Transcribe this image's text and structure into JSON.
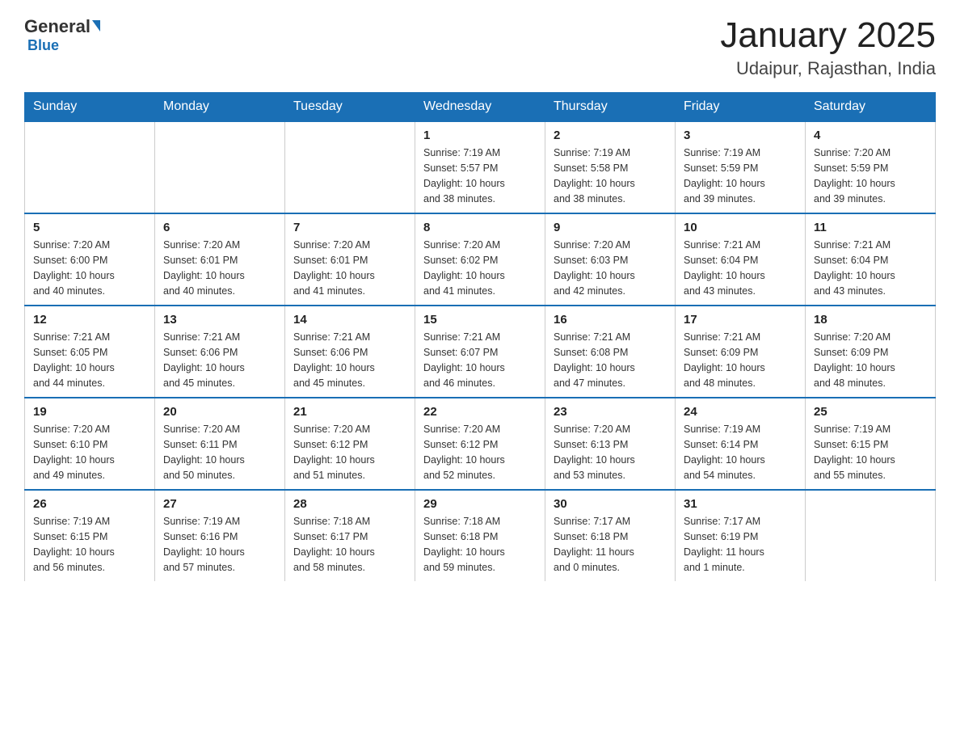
{
  "header": {
    "logo_general": "General",
    "logo_blue": "Blue",
    "month_title": "January 2025",
    "location": "Udaipur, Rajasthan, India"
  },
  "days_of_week": [
    "Sunday",
    "Monday",
    "Tuesday",
    "Wednesday",
    "Thursday",
    "Friday",
    "Saturday"
  ],
  "weeks": [
    [
      {
        "day": "",
        "info": ""
      },
      {
        "day": "",
        "info": ""
      },
      {
        "day": "",
        "info": ""
      },
      {
        "day": "1",
        "info": "Sunrise: 7:19 AM\nSunset: 5:57 PM\nDaylight: 10 hours\nand 38 minutes."
      },
      {
        "day": "2",
        "info": "Sunrise: 7:19 AM\nSunset: 5:58 PM\nDaylight: 10 hours\nand 38 minutes."
      },
      {
        "day": "3",
        "info": "Sunrise: 7:19 AM\nSunset: 5:59 PM\nDaylight: 10 hours\nand 39 minutes."
      },
      {
        "day": "4",
        "info": "Sunrise: 7:20 AM\nSunset: 5:59 PM\nDaylight: 10 hours\nand 39 minutes."
      }
    ],
    [
      {
        "day": "5",
        "info": "Sunrise: 7:20 AM\nSunset: 6:00 PM\nDaylight: 10 hours\nand 40 minutes."
      },
      {
        "day": "6",
        "info": "Sunrise: 7:20 AM\nSunset: 6:01 PM\nDaylight: 10 hours\nand 40 minutes."
      },
      {
        "day": "7",
        "info": "Sunrise: 7:20 AM\nSunset: 6:01 PM\nDaylight: 10 hours\nand 41 minutes."
      },
      {
        "day": "8",
        "info": "Sunrise: 7:20 AM\nSunset: 6:02 PM\nDaylight: 10 hours\nand 41 minutes."
      },
      {
        "day": "9",
        "info": "Sunrise: 7:20 AM\nSunset: 6:03 PM\nDaylight: 10 hours\nand 42 minutes."
      },
      {
        "day": "10",
        "info": "Sunrise: 7:21 AM\nSunset: 6:04 PM\nDaylight: 10 hours\nand 43 minutes."
      },
      {
        "day": "11",
        "info": "Sunrise: 7:21 AM\nSunset: 6:04 PM\nDaylight: 10 hours\nand 43 minutes."
      }
    ],
    [
      {
        "day": "12",
        "info": "Sunrise: 7:21 AM\nSunset: 6:05 PM\nDaylight: 10 hours\nand 44 minutes."
      },
      {
        "day": "13",
        "info": "Sunrise: 7:21 AM\nSunset: 6:06 PM\nDaylight: 10 hours\nand 45 minutes."
      },
      {
        "day": "14",
        "info": "Sunrise: 7:21 AM\nSunset: 6:06 PM\nDaylight: 10 hours\nand 45 minutes."
      },
      {
        "day": "15",
        "info": "Sunrise: 7:21 AM\nSunset: 6:07 PM\nDaylight: 10 hours\nand 46 minutes."
      },
      {
        "day": "16",
        "info": "Sunrise: 7:21 AM\nSunset: 6:08 PM\nDaylight: 10 hours\nand 47 minutes."
      },
      {
        "day": "17",
        "info": "Sunrise: 7:21 AM\nSunset: 6:09 PM\nDaylight: 10 hours\nand 48 minutes."
      },
      {
        "day": "18",
        "info": "Sunrise: 7:20 AM\nSunset: 6:09 PM\nDaylight: 10 hours\nand 48 minutes."
      }
    ],
    [
      {
        "day": "19",
        "info": "Sunrise: 7:20 AM\nSunset: 6:10 PM\nDaylight: 10 hours\nand 49 minutes."
      },
      {
        "day": "20",
        "info": "Sunrise: 7:20 AM\nSunset: 6:11 PM\nDaylight: 10 hours\nand 50 minutes."
      },
      {
        "day": "21",
        "info": "Sunrise: 7:20 AM\nSunset: 6:12 PM\nDaylight: 10 hours\nand 51 minutes."
      },
      {
        "day": "22",
        "info": "Sunrise: 7:20 AM\nSunset: 6:12 PM\nDaylight: 10 hours\nand 52 minutes."
      },
      {
        "day": "23",
        "info": "Sunrise: 7:20 AM\nSunset: 6:13 PM\nDaylight: 10 hours\nand 53 minutes."
      },
      {
        "day": "24",
        "info": "Sunrise: 7:19 AM\nSunset: 6:14 PM\nDaylight: 10 hours\nand 54 minutes."
      },
      {
        "day": "25",
        "info": "Sunrise: 7:19 AM\nSunset: 6:15 PM\nDaylight: 10 hours\nand 55 minutes."
      }
    ],
    [
      {
        "day": "26",
        "info": "Sunrise: 7:19 AM\nSunset: 6:15 PM\nDaylight: 10 hours\nand 56 minutes."
      },
      {
        "day": "27",
        "info": "Sunrise: 7:19 AM\nSunset: 6:16 PM\nDaylight: 10 hours\nand 57 minutes."
      },
      {
        "day": "28",
        "info": "Sunrise: 7:18 AM\nSunset: 6:17 PM\nDaylight: 10 hours\nand 58 minutes."
      },
      {
        "day": "29",
        "info": "Sunrise: 7:18 AM\nSunset: 6:18 PM\nDaylight: 10 hours\nand 59 minutes."
      },
      {
        "day": "30",
        "info": "Sunrise: 7:17 AM\nSunset: 6:18 PM\nDaylight: 11 hours\nand 0 minutes."
      },
      {
        "day": "31",
        "info": "Sunrise: 7:17 AM\nSunset: 6:19 PM\nDaylight: 11 hours\nand 1 minute."
      },
      {
        "day": "",
        "info": ""
      }
    ]
  ]
}
